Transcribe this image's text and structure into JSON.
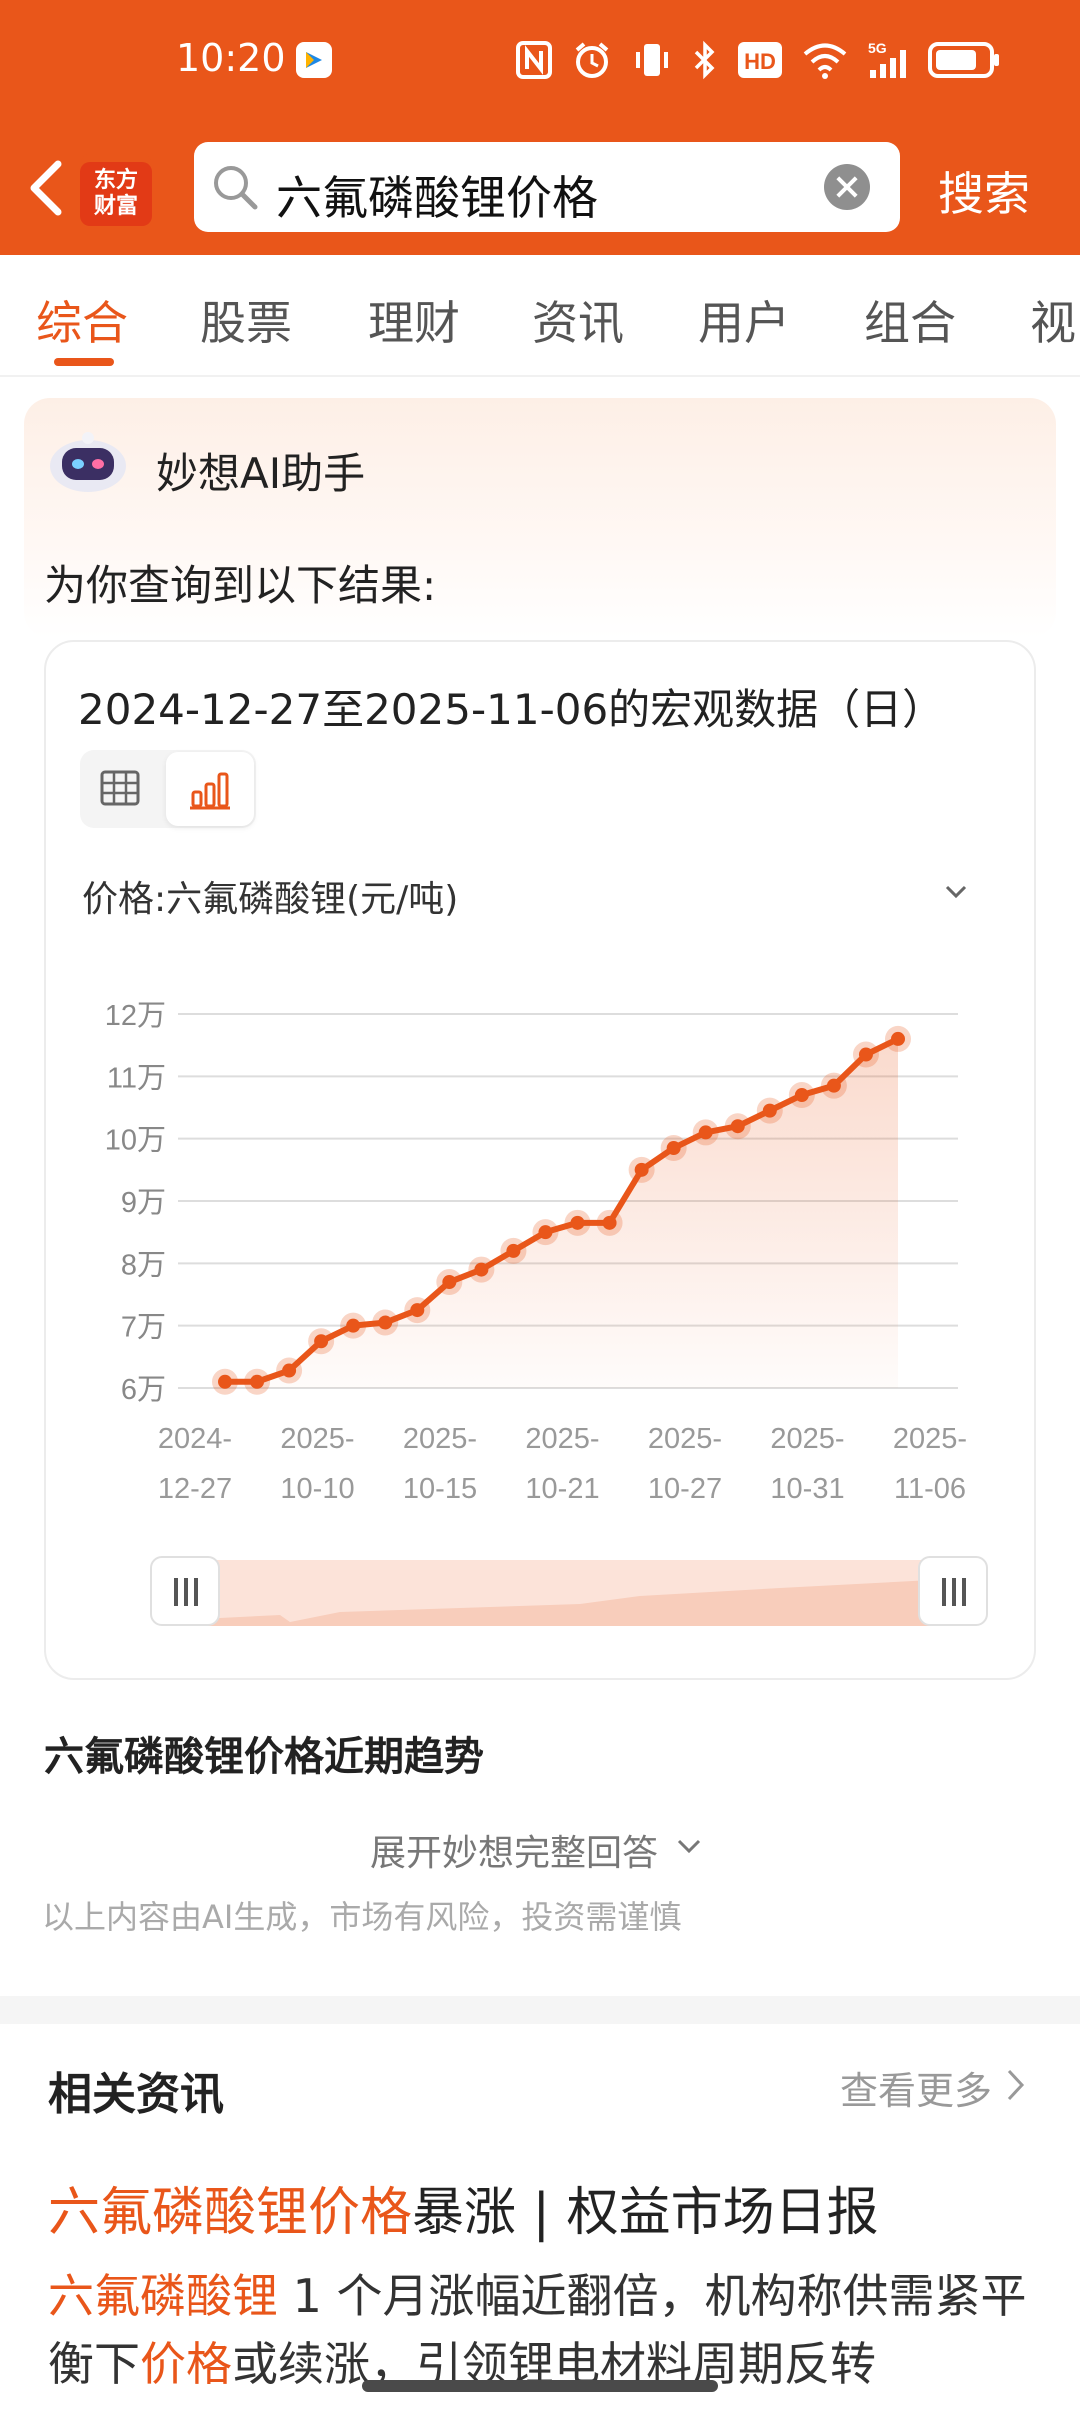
{
  "status_bar": {
    "time": "10:20",
    "icons": [
      "nfc-icon",
      "alarm-icon",
      "vibrate-icon",
      "bluetooth-icon",
      "hd-icon",
      "wifi-icon",
      "signal-5g-icon",
      "battery-icon"
    ]
  },
  "header": {
    "logo_line1": "东方",
    "logo_line2": "财富",
    "search_query": "六氟磷酸锂价格",
    "search_button": "搜索",
    "accent": "#E9561A"
  },
  "tabs": [
    {
      "label": "综合",
      "active": true
    },
    {
      "label": "股票"
    },
    {
      "label": "理财"
    },
    {
      "label": "资讯"
    },
    {
      "label": "用户"
    },
    {
      "label": "组合"
    },
    {
      "label": "视"
    }
  ],
  "ai_card": {
    "title": "妙想AI助手",
    "subtitle": "为你查询到以下结果:"
  },
  "chart_card": {
    "range_title": "2024-12-27至2025-11-06的宏观数据（日）",
    "series_selector": "价格:六氟磷酸锂(元/吨)"
  },
  "chart_data": {
    "type": "area",
    "ytick_labels": [
      "12万",
      "11万",
      "10万",
      "9万",
      "8万",
      "7万",
      "6万"
    ],
    "ylim": [
      60000,
      120000
    ],
    "xtick_labels": [
      [
        "2024-",
        "12-27"
      ],
      [
        "2025-",
        "10-10"
      ],
      [
        "2025-",
        "10-15"
      ],
      [
        "2025-",
        "10-21"
      ],
      [
        "2025-",
        "10-27"
      ],
      [
        "2025-",
        "10-31"
      ],
      [
        "2025-",
        "11-06"
      ]
    ],
    "series": [
      {
        "values": [
          61000,
          61000,
          62800,
          67500,
          70000,
          70500,
          72500,
          77000,
          79000,
          82000,
          85000,
          86500,
          86500,
          95000,
          98500,
          101000,
          102000,
          104500,
          107000,
          108500,
          113500,
          116000
        ]
      }
    ],
    "color": "#E9561A",
    "grid": true
  },
  "trend": {
    "title": "六氟磷酸锂价格近期趋势",
    "expand": "展开妙想完整回答",
    "disclaimer": "以上内容由AI生成，市场有风险，投资需谨慎"
  },
  "news": {
    "header": "相关资讯",
    "more": "查看更多",
    "title_highlight": "六氟磷酸锂价格",
    "title_rest": "暴涨 | 权益市场日报",
    "body_hl1": "六氟磷酸锂",
    "body_t1": " 1 个月涨幅近翻倍，机构称供需紧平衡下",
    "body_hl2": "价格",
    "body_t2": "或续涨，引领锂电材料周期反转"
  }
}
